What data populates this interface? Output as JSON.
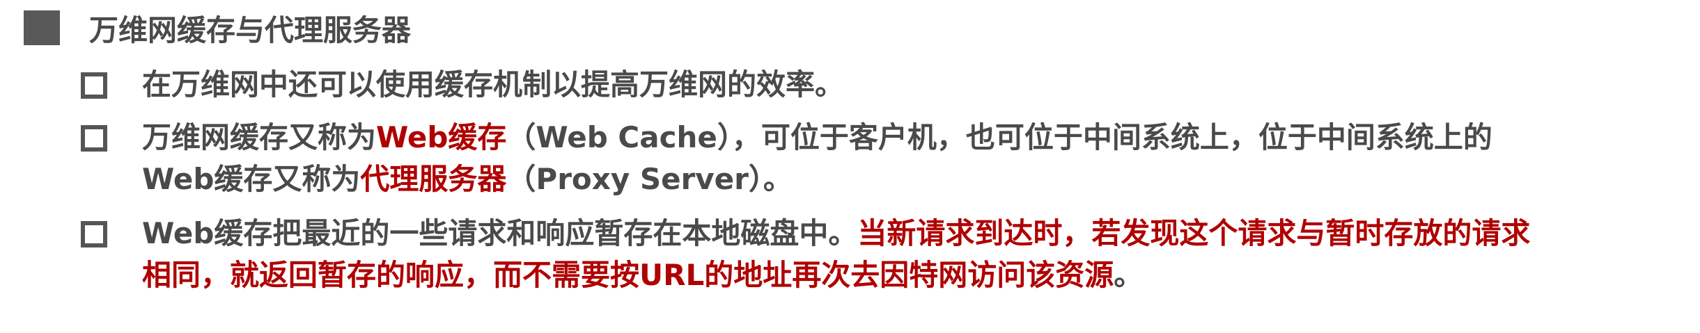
{
  "heading": {
    "title": "万维网缓存与代理服务器"
  },
  "items": [
    {
      "lines": [
        [
          {
            "text": "在万维网中还可以使用缓存机制以提高万维网的效率。",
            "highlight": false
          }
        ]
      ]
    },
    {
      "lines": [
        [
          {
            "text": "万维网缓存又称为",
            "highlight": false
          },
          {
            "text": "Web缓存",
            "highlight": true
          },
          {
            "text": "（Web Cache），可位于客户机，也可位于中间系统上，位于中间系统上的",
            "highlight": false
          }
        ],
        [
          {
            "text": "Web缓存又称为",
            "highlight": false
          },
          {
            "text": "代理服务器",
            "highlight": true
          },
          {
            "text": "（Proxy Server）。",
            "highlight": false
          }
        ]
      ]
    },
    {
      "lines": [
        [
          {
            "text": "Web缓存把最近的一些请求和响应暂存在本地磁盘中。",
            "highlight": false
          },
          {
            "text": "当新请求到达时，若发现这个请求与暂时存放的请求",
            "highlight": true
          }
        ],
        [
          {
            "text": "相同，就返回暂存的响应，而不需要按URL的地址再次去因特网访问该资源",
            "highlight": true
          },
          {
            "text": "。",
            "highlight": false
          }
        ]
      ]
    }
  ],
  "colors": {
    "text": "#4a4a4a",
    "highlight": "#b00000",
    "bullet": "#595959"
  }
}
